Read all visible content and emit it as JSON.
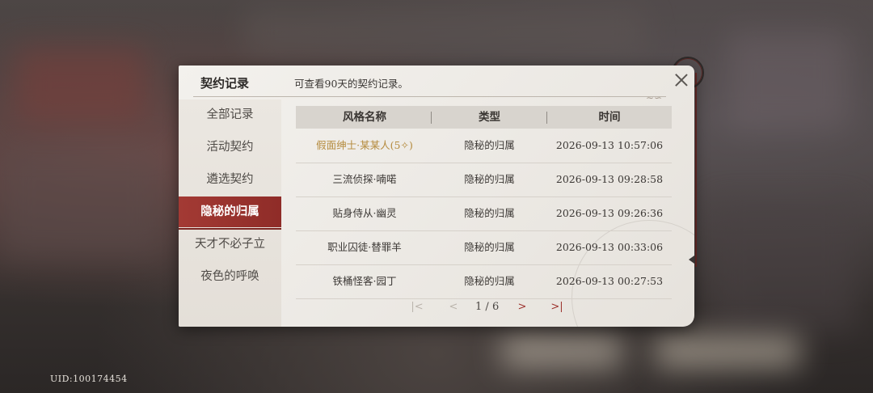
{
  "footer": {
    "uid": "UID:100174454"
  },
  "panel": {
    "title": "契约记录",
    "description": "可查看90天的契约记录。"
  },
  "sidebar": {
    "items": [
      {
        "label": "全部记录",
        "active": false
      },
      {
        "label": "活动契约",
        "active": false
      },
      {
        "label": "遴选契约",
        "active": false
      },
      {
        "label": "隐秘的归属",
        "active": true
      },
      {
        "label": "天才不必子立",
        "active": false
      },
      {
        "label": "夜色的呼唤",
        "active": false
      }
    ]
  },
  "table": {
    "headers": [
      "风格名称",
      "类型",
      "时间"
    ],
    "rows": [
      {
        "name": "假面绅士·某某人(5✧)",
        "type": "隐秘的归属",
        "time": "2026-09-13 10:57:06",
        "highlight": true
      },
      {
        "name": "三流侦探·喃喏",
        "type": "隐秘的归属",
        "time": "2026-09-13 09:28:58",
        "highlight": false
      },
      {
        "name": "贴身侍从·幽灵",
        "type": "隐秘的归属",
        "time": "2026-09-13 09:26:36",
        "highlight": false
      },
      {
        "name": "职业囚徒·替罪羊",
        "type": "隐秘的归属",
        "time": "2026-09-13 00:33:06",
        "highlight": false
      },
      {
        "name": "铁桶怪客·园丁",
        "type": "隐秘的归属",
        "time": "2026-09-13 00:27:53",
        "highlight": false
      }
    ]
  },
  "pagination": {
    "current": "1",
    "separator": "/",
    "total": "6",
    "first_icon": "|<",
    "prev_icon": "<",
    "next_icon": ">",
    "last_icon": ">|"
  },
  "colors": {
    "accent": "#9b2f2a",
    "highlight_text": "#b58b3e",
    "panel_bg": "#f0ede8"
  }
}
